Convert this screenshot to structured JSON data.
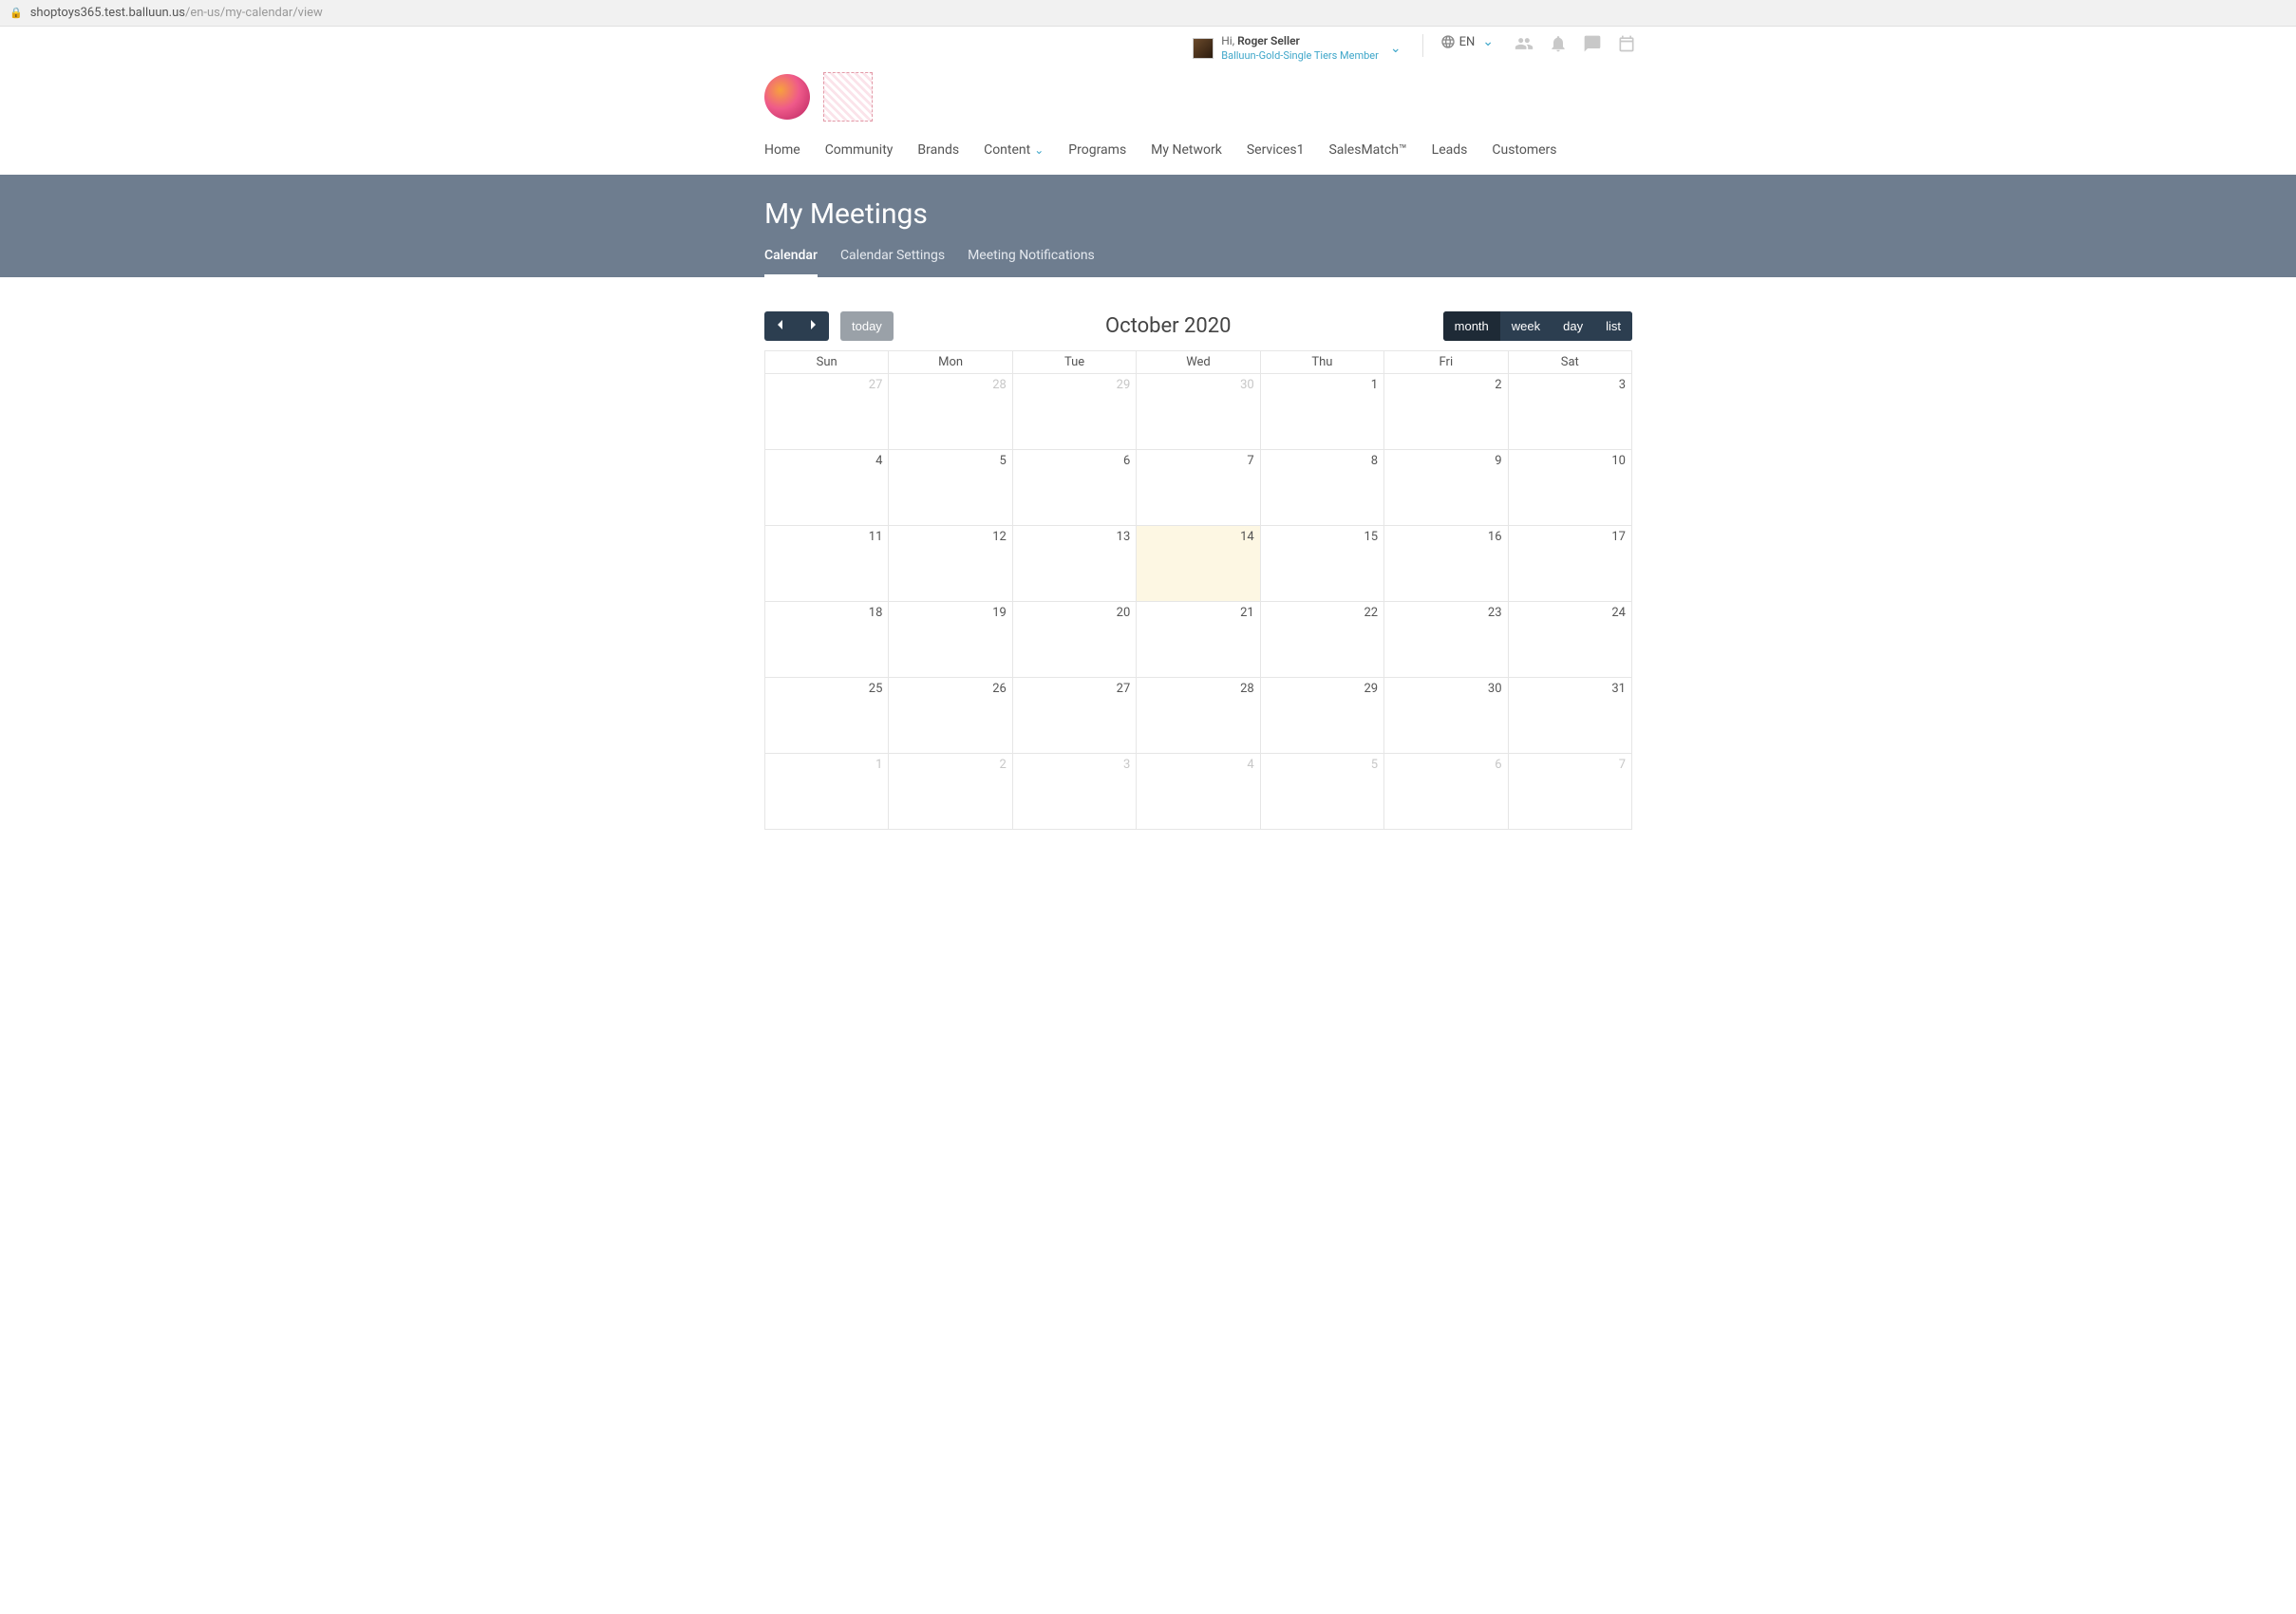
{
  "url": {
    "host": "shoptoys365.test.balluun.us",
    "path": "/en-us/my-calendar/view"
  },
  "user": {
    "greeting": "Hi, ",
    "name": "Roger Seller",
    "membership": "Balluun-Gold-Single Tiers Member"
  },
  "lang": "EN",
  "nav": [
    "Home",
    "Community",
    "Brands",
    "Content",
    "Programs",
    "My Network",
    "Services1",
    "SalesMatch™",
    "Leads",
    "Customers"
  ],
  "nav_dropdown_index": 3,
  "hero": {
    "title": "My Meetings",
    "tabs": [
      "Calendar",
      "Calendar Settings",
      "Meeting Notifications"
    ],
    "active": 0
  },
  "calendar": {
    "title": "October 2020",
    "today_label": "today",
    "views": [
      "month",
      "week",
      "day",
      "list"
    ],
    "active_view": 0,
    "day_headers": [
      "Sun",
      "Mon",
      "Tue",
      "Wed",
      "Thu",
      "Fri",
      "Sat"
    ],
    "weeks": [
      [
        {
          "d": "27",
          "other": true
        },
        {
          "d": "28",
          "other": true
        },
        {
          "d": "29",
          "other": true
        },
        {
          "d": "30",
          "other": true
        },
        {
          "d": "1"
        },
        {
          "d": "2"
        },
        {
          "d": "3"
        }
      ],
      [
        {
          "d": "4"
        },
        {
          "d": "5"
        },
        {
          "d": "6"
        },
        {
          "d": "7"
        },
        {
          "d": "8"
        },
        {
          "d": "9"
        },
        {
          "d": "10"
        }
      ],
      [
        {
          "d": "11"
        },
        {
          "d": "12"
        },
        {
          "d": "13"
        },
        {
          "d": "14",
          "today": true
        },
        {
          "d": "15"
        },
        {
          "d": "16"
        },
        {
          "d": "17"
        }
      ],
      [
        {
          "d": "18"
        },
        {
          "d": "19"
        },
        {
          "d": "20"
        },
        {
          "d": "21"
        },
        {
          "d": "22"
        },
        {
          "d": "23"
        },
        {
          "d": "24"
        }
      ],
      [
        {
          "d": "25"
        },
        {
          "d": "26"
        },
        {
          "d": "27"
        },
        {
          "d": "28"
        },
        {
          "d": "29"
        },
        {
          "d": "30"
        },
        {
          "d": "31"
        }
      ],
      [
        {
          "d": "1",
          "other": true
        },
        {
          "d": "2",
          "other": true
        },
        {
          "d": "3",
          "other": true
        },
        {
          "d": "4",
          "other": true
        },
        {
          "d": "5",
          "other": true
        },
        {
          "d": "6",
          "other": true
        },
        {
          "d": "7",
          "other": true
        }
      ]
    ]
  }
}
